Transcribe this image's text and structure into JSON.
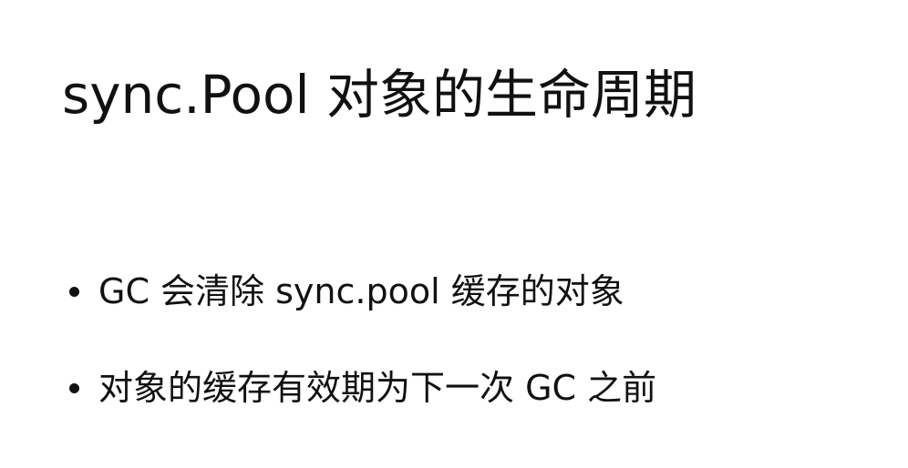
{
  "slide": {
    "title": "sync.Pool 对象的生命周期",
    "bullets": [
      {
        "text": "GC 会清除 sync.pool 缓存的对象"
      },
      {
        "text": "对象的缓存有效期为下一次 GC 之前"
      }
    ]
  },
  "colors": {
    "background": "#ffffff",
    "text": "#111111"
  }
}
